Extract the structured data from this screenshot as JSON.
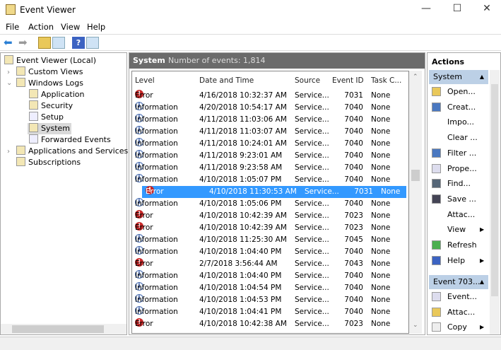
{
  "window": {
    "title": "Event Viewer",
    "min": "—",
    "max": "☐",
    "close": "✕"
  },
  "menu": [
    "File",
    "Action",
    "View",
    "Help"
  ],
  "tree": {
    "root": "Event Viewer (Local)",
    "items": [
      {
        "label": "Custom Views"
      },
      {
        "label": "Windows Logs"
      },
      {
        "label": "Application"
      },
      {
        "label": "Security"
      },
      {
        "label": "Setup"
      },
      {
        "label": "System",
        "selected": true
      },
      {
        "label": "Forwarded Events"
      },
      {
        "label": "Applications and Services Lo"
      },
      {
        "label": "Subscriptions"
      }
    ]
  },
  "center": {
    "log_name": "System",
    "count_text": "Number of events: 1,814",
    "columns": [
      "Level",
      "Date and Time",
      "Source",
      "Event ID",
      "Task C..."
    ],
    "rows": [
      [
        "Error",
        "4/16/2018 10:32:37 AM",
        "Service...",
        "7031",
        "None"
      ],
      [
        "Information",
        "4/20/2018 10:54:17 AM",
        "Service...",
        "7040",
        "None"
      ],
      [
        "Information",
        "4/11/2018 11:03:06 AM",
        "Service...",
        "7040",
        "None"
      ],
      [
        "Information",
        "4/11/2018 11:03:07 AM",
        "Service...",
        "7040",
        "None"
      ],
      [
        "Information",
        "4/11/2018 10:24:01 AM",
        "Service...",
        "7040",
        "None"
      ],
      [
        "Information",
        "4/11/2018 9:23:01 AM",
        "Service...",
        "7040",
        "None"
      ],
      [
        "Information",
        "4/11/2018 9:23:58 AM",
        "Service...",
        "7040",
        "None"
      ],
      [
        "Information",
        "4/10/2018 1:05:07 PM",
        "Service...",
        "7040",
        "None"
      ],
      [
        "Error",
        "4/10/2018 11:30:53 AM",
        "Service...",
        "7031",
        "None"
      ],
      [
        "Information",
        "4/10/2018 1:05:06 PM",
        "Service...",
        "7040",
        "None"
      ],
      [
        "Error",
        "4/10/2018 10:42:39 AM",
        "Service...",
        "7023",
        "None"
      ],
      [
        "Error",
        "4/10/2018 10:42:39 AM",
        "Service...",
        "7023",
        "None"
      ],
      [
        "Information",
        "4/10/2018 11:25:30 AM",
        "Service...",
        "7045",
        "None"
      ],
      [
        "Information",
        "4/10/2018 1:04:40 PM",
        "Service...",
        "7040",
        "None"
      ],
      [
        "Error",
        "2/7/2018 3:56:44 AM",
        "Service...",
        "7043",
        "None"
      ],
      [
        "Information",
        "4/10/2018 1:04:40 PM",
        "Service...",
        "7040",
        "None"
      ],
      [
        "Information",
        "4/10/2018 1:04:54 PM",
        "Service...",
        "7040",
        "None"
      ],
      [
        "Information",
        "4/10/2018 1:04:53 PM",
        "Service...",
        "7040",
        "None"
      ],
      [
        "Information",
        "4/10/2018 1:04:41 PM",
        "Service...",
        "7040",
        "None"
      ],
      [
        "Error",
        "4/10/2018 10:42:38 AM",
        "Service...",
        "7023",
        "None"
      ]
    ],
    "selected_row": 8
  },
  "actions": {
    "title": "Actions",
    "section1": "System",
    "items1": [
      {
        "label": "Open...",
        "icon": "folder-icon"
      },
      {
        "label": "Creat...",
        "icon": "filter-icon"
      },
      {
        "label": "Impo...",
        "icon": ""
      },
      {
        "label": "Clear ...",
        "icon": ""
      },
      {
        "label": "Filter ...",
        "icon": "filter-icon"
      },
      {
        "label": "Prope...",
        "icon": "properties-icon"
      },
      {
        "label": "Find...",
        "icon": "binoculars-icon"
      },
      {
        "label": "Save ...",
        "icon": "save-icon"
      },
      {
        "label": "Attac...",
        "icon": ""
      },
      {
        "label": "View",
        "icon": "",
        "submenu": true
      },
      {
        "label": "Refresh",
        "icon": "refresh-icon"
      },
      {
        "label": "Help",
        "icon": "help-icon",
        "submenu": true
      }
    ],
    "section2": "Event 703...",
    "items2": [
      {
        "label": "Event...",
        "icon": "properties-icon"
      },
      {
        "label": "Attac...",
        "icon": "task-icon"
      },
      {
        "label": "Copy",
        "icon": "copy-icon",
        "submenu": true
      }
    ]
  },
  "colors": {
    "selection": "#3399ff",
    "header": "#6b6b6b",
    "section": "#bcd0e6",
    "error": "#c62828"
  }
}
